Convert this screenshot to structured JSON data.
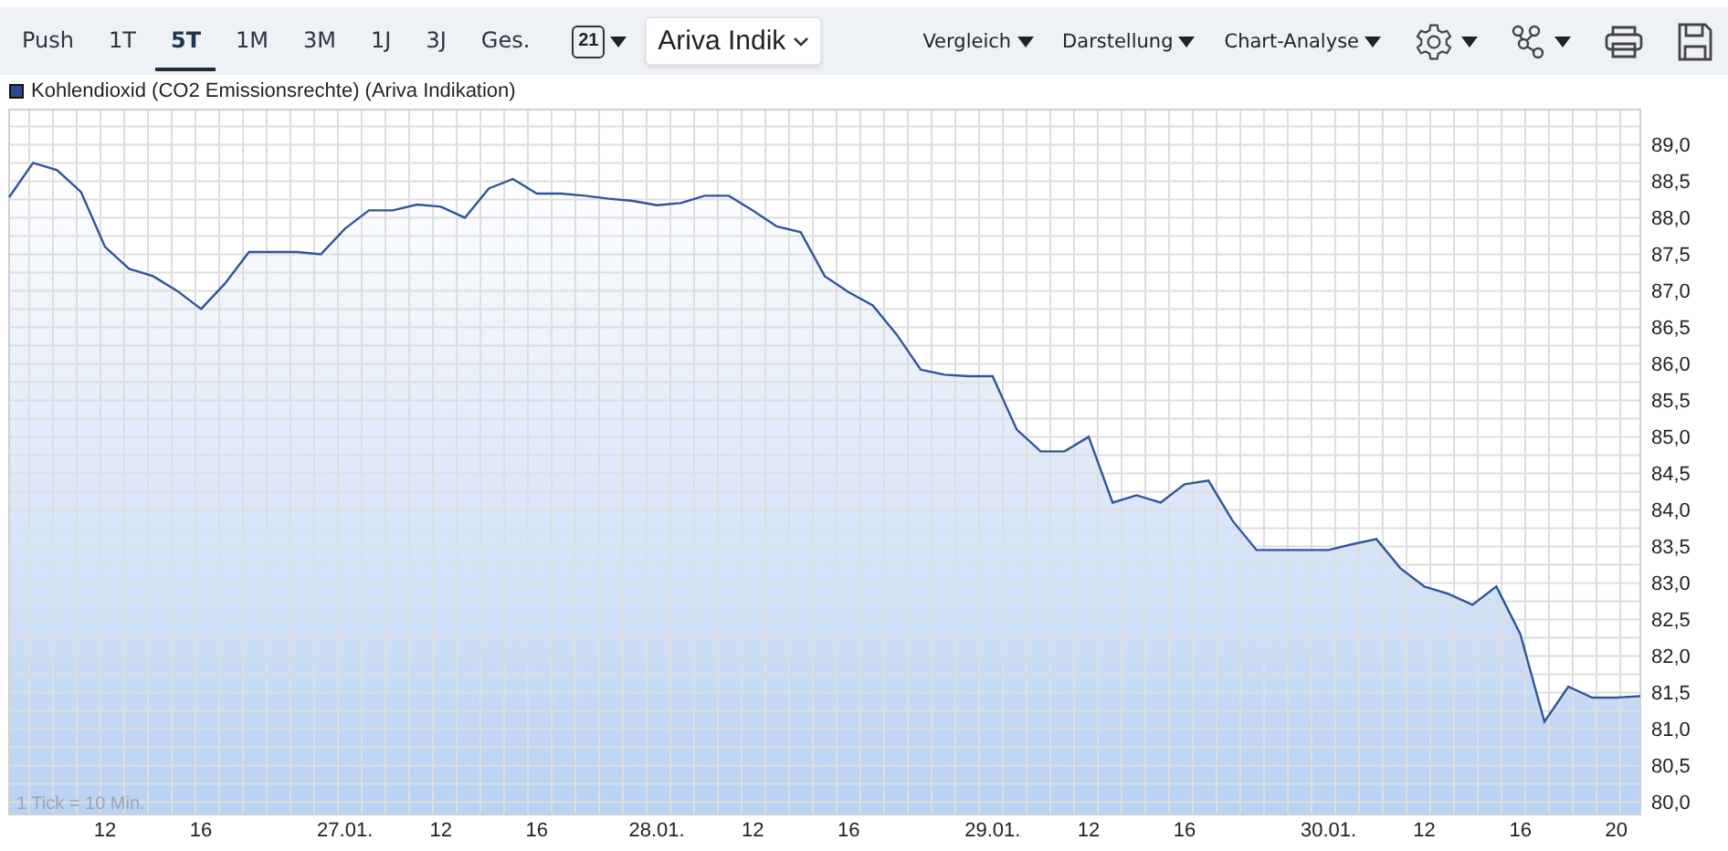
{
  "toolbar": {
    "tabs": [
      {
        "label": "Push",
        "selected": false
      },
      {
        "label": "1T",
        "selected": false
      },
      {
        "label": "5T",
        "selected": true
      },
      {
        "label": "1M",
        "selected": false
      },
      {
        "label": "3M",
        "selected": false
      },
      {
        "label": "1J",
        "selected": false
      },
      {
        "label": "3J",
        "selected": false
      },
      {
        "label": "Ges.",
        "selected": false
      }
    ],
    "calendar_day": "21",
    "source_dropdown": "Ariva Indik",
    "menus": [
      "Vergleich",
      "Darstellung",
      "Chart-Analyse"
    ]
  },
  "legend": {
    "label": "Kohlendioxid (CO2 Emissionsrechte) (Ariva Indikation)",
    "color": "#2b4a8e"
  },
  "chart": {
    "tick_note": "1 Tick = 10 Min.",
    "chart_data": {
      "type": "area",
      "grid": true,
      "ylim": [
        79.83,
        89.48
      ],
      "yticks": [
        {
          "value": 80,
          "label": "80,0"
        },
        {
          "value": 80.5,
          "label": "80,5"
        },
        {
          "value": 81,
          "label": "81,0"
        },
        {
          "value": 81.5,
          "label": "81,5"
        },
        {
          "value": 82,
          "label": "82,0"
        },
        {
          "value": 82.5,
          "label": "82,5"
        },
        {
          "value": 83,
          "label": "83,0"
        },
        {
          "value": 83.5,
          "label": "83,5"
        },
        {
          "value": 84,
          "label": "84,0"
        },
        {
          "value": 84.5,
          "label": "84,5"
        },
        {
          "value": 85,
          "label": "85,0"
        },
        {
          "value": 85.5,
          "label": "85,5"
        },
        {
          "value": 86,
          "label": "86,0"
        },
        {
          "value": 86.5,
          "label": "86,5"
        },
        {
          "value": 87,
          "label": "87,0"
        },
        {
          "value": 87.5,
          "label": "87,5"
        },
        {
          "value": 88,
          "label": "88,0"
        },
        {
          "value": 88.5,
          "label": "88,5"
        },
        {
          "value": 89,
          "label": "89,0"
        }
      ],
      "categories": [
        null,
        null,
        null,
        null,
        "12",
        null,
        null,
        null,
        "16",
        null,
        null,
        null,
        null,
        null,
        "27.01.",
        null,
        null,
        null,
        "12",
        null,
        null,
        null,
        "16",
        null,
        null,
        null,
        null,
        "28.01.",
        null,
        null,
        null,
        "12",
        null,
        null,
        null,
        "16",
        null,
        null,
        null,
        null,
        null,
        "29.01.",
        null,
        null,
        null,
        "12",
        null,
        null,
        null,
        "16",
        null,
        null,
        null,
        null,
        null,
        "30.01.",
        null,
        null,
        null,
        "12",
        null,
        null,
        null,
        "16",
        null,
        null,
        null,
        "20",
        null
      ],
      "series": [
        {
          "color": "#2f5597",
          "values": [
            88.28,
            88.75,
            88.65,
            88.35,
            87.6,
            87.3,
            87.2,
            87.0,
            86.75,
            87.1,
            87.53,
            87.53,
            87.53,
            87.5,
            87.85,
            88.1,
            88.1,
            88.18,
            88.15,
            88.0,
            88.4,
            88.53,
            88.33,
            88.33,
            88.3,
            88.26,
            88.23,
            88.17,
            88.2,
            88.3,
            88.3,
            88.1,
            87.88,
            87.8,
            87.2,
            86.98,
            86.8,
            86.4,
            85.92,
            85.85,
            85.83,
            85.83,
            85.1,
            84.8,
            84.8,
            85.0,
            84.1,
            84.2,
            84.1,
            84.35,
            84.4,
            83.85,
            83.45,
            83.45,
            83.45,
            83.45,
            83.53,
            83.6,
            83.2,
            82.95,
            82.85,
            82.7,
            82.95,
            82.3,
            81.1,
            81.58,
            81.43,
            81.43,
            81.45
          ]
        }
      ]
    }
  }
}
